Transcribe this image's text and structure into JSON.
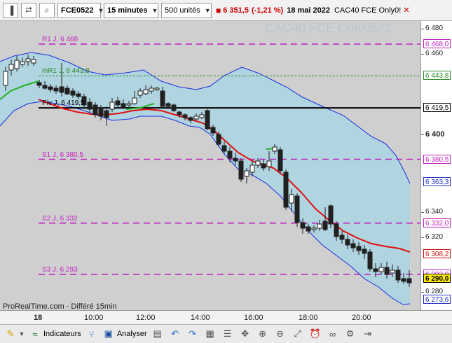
{
  "toolbar": {
    "instrument": "FCE0522",
    "timeframe": "15 minutes",
    "units": "500 unités",
    "price": "6 351,5",
    "change": "(-1,21 %)",
    "date": "18 mai 2022",
    "instrument_name": "CAC40 FCE Only0!"
  },
  "chart": {
    "watermark": "CAC40 FCE Only0522",
    "credit": "ProRealTime.com - Différé 15min",
    "levels": [
      {
        "name": "R1 J",
        "label": "R1 J, 6 468",
        "value": 6468,
        "badge": "6 468,0",
        "color": "#c020c0"
      },
      {
        "name": "mR1 J",
        "label": "mR1 J, 6 443,8",
        "value": 6443.8,
        "badge": "6 443,8",
        "color": "#2a8a2a"
      },
      {
        "name": "Piv J",
        "label": "Piv J, 6 419,5",
        "value": 6419.5,
        "badge": "6 419,5",
        "color": "#000000"
      },
      {
        "name": "S1 J",
        "label": "S1 J, 6 380,5",
        "value": 6380.5,
        "badge": "6 380,5",
        "color": "#c020c0"
      },
      {
        "name": "S2 J",
        "label": "S2 J, 6 332",
        "value": 6332,
        "badge": "6 332,0",
        "color": "#c020c0"
      },
      {
        "name": "S3 J",
        "label": "S3 J, 6 293",
        "value": 6293,
        "badge": "6 293,0",
        "color": "#c020c0"
      }
    ],
    "price_axis_ticks": [
      "6 480",
      "6 460",
      "6 400",
      "6 340",
      "6 320",
      "6 280"
    ],
    "price_badges": [
      {
        "text": "6 363,3",
        "value": 6363.3,
        "color": "#2030c0"
      },
      {
        "text": "6 308,2",
        "value": 6308.2,
        "color": "#d01010"
      },
      {
        "text": "6 290,0",
        "value": 6290.0,
        "color": "#000000"
      },
      {
        "text": "6 273,6",
        "value": 6273.6,
        "color": "#2030c0"
      }
    ],
    "time_labels": [
      "18",
      "10:00",
      "12:00",
      "14:00",
      "16:00",
      "18:00",
      "20:00"
    ],
    "colors": {
      "band_fill": "#b0d4e0",
      "band_line": "#1a2ee0",
      "ma_red": "#e01010",
      "ma_green": "#22b022",
      "candle_up": "#ffffff",
      "candle_down": "#202020"
    }
  },
  "bottombar": {
    "indicators_label": "Indicateurs",
    "analyse_label": "Analyser"
  }
}
